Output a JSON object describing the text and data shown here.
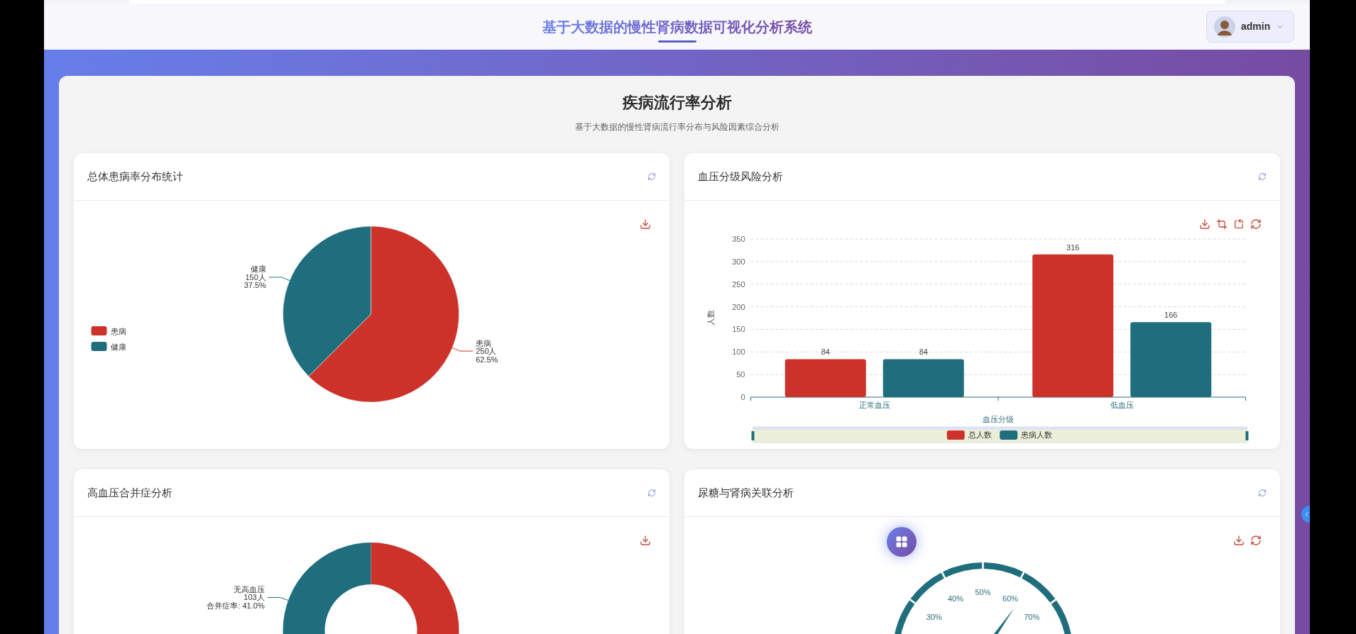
{
  "header": {
    "title": "基于大数据的慢性肾病数据可视化分析系统",
    "user": "admin"
  },
  "page": {
    "title": "疾病流行率分析",
    "subtitle": "基于大数据的慢性肾病流行率分布与风险因素综合分析"
  },
  "cards": [
    {
      "kind": "chart",
      "title": "总体患病率分布统计",
      "chart_data": {
        "type": "pie",
        "categories": [
          "患病",
          "健康"
        ],
        "values": [
          62.5,
          37.5
        ],
        "colors": [
          "#cc3229",
          "#206e7d"
        ],
        "value_labels": [
          [
            "250人",
            "62.5%"
          ],
          [
            "150人",
            "37.5%"
          ]
        ],
        "legend": "left"
      }
    },
    {
      "kind": "chart",
      "title": "血压分级风险分析",
      "chart_data": {
        "type": "bar",
        "xlabel": "血压分级",
        "ylabel": "人数",
        "categories": [
          "正常血压",
          "低血压"
        ],
        "series": [
          {
            "name": "总人数",
            "color": "#cc3229",
            "values": [
              84,
              316
            ]
          },
          {
            "name": "患病人数",
            "color": "#206e7d",
            "values": [
              84,
              166
            ]
          }
        ],
        "ylim": [
          0,
          350
        ],
        "yticks": [
          0,
          50,
          100,
          150,
          200,
          250,
          300,
          350
        ],
        "grid": true,
        "data_labels": true,
        "legend": "bottom"
      }
    },
    {
      "kind": "donut",
      "title": "高血压合并症分析",
      "label": [
        "无高血压",
        "103人",
        "合并症率: 41.0%"
      ]
    },
    {
      "kind": "gauge",
      "title": "尿糖与肾病关联分析",
      "ticks": [
        "30%",
        "40%",
        "50%",
        "60%",
        "70%"
      ],
      "level": 0.63
    }
  ]
}
